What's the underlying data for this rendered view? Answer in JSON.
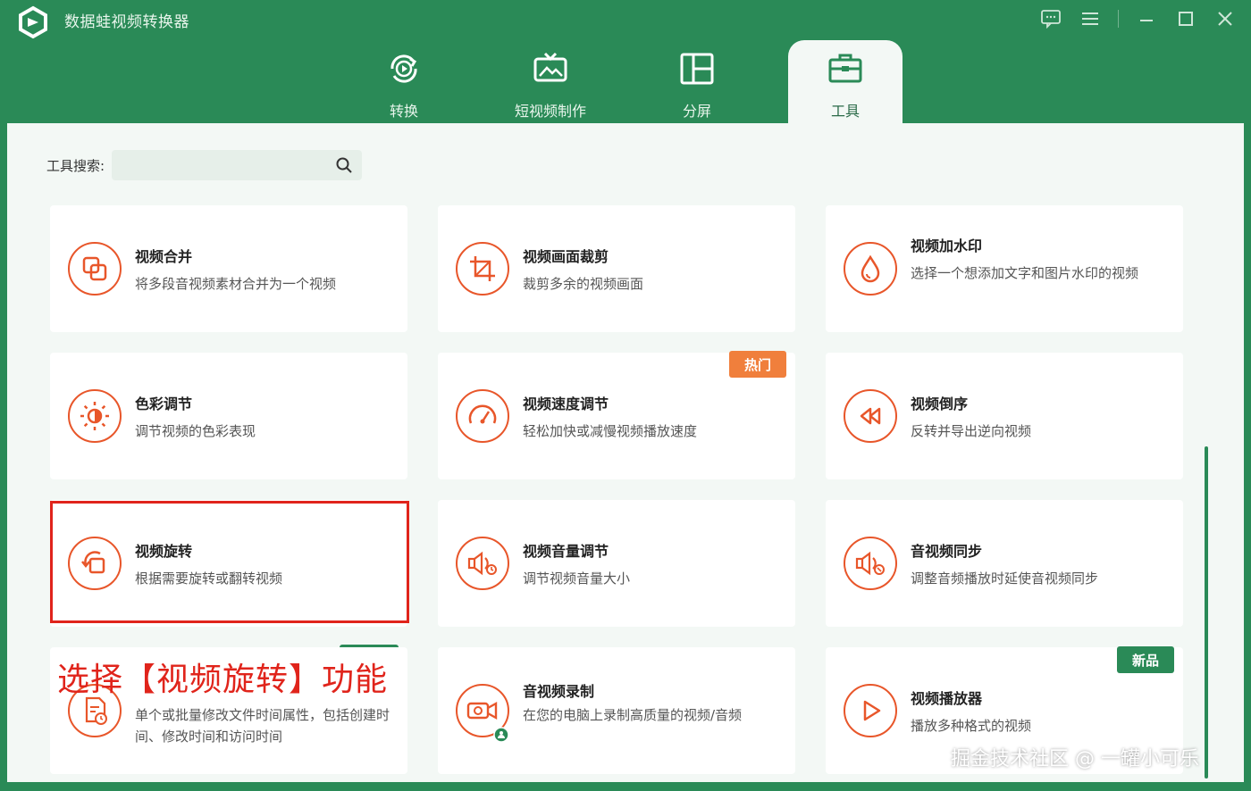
{
  "app": {
    "title": "数据蛙视频转换器"
  },
  "tabs": [
    {
      "label": "转换",
      "icon": "convert-icon"
    },
    {
      "label": "短视频制作",
      "icon": "tv-icon"
    },
    {
      "label": "分屏",
      "icon": "split-screen-icon"
    },
    {
      "label": "工具",
      "icon": "toolbox-icon",
      "active": true
    }
  ],
  "search": {
    "label": "工具搜索:",
    "placeholder": "",
    "value": ""
  },
  "tools": [
    {
      "title": "视频合并",
      "desc": "将多段音视频素材合并为一个视频",
      "icon": "merge-icon"
    },
    {
      "title": "视频画面裁剪",
      "desc": "裁剪多余的视频画面",
      "icon": "crop-icon"
    },
    {
      "title": "视频加水印",
      "desc": "选择一个想添加文字和图片水印的视频",
      "icon": "watermark-drop-icon"
    },
    {
      "title": "色彩调节",
      "desc": "调节视频的色彩表现",
      "icon": "color-adjust-icon"
    },
    {
      "title": "视频速度调节",
      "desc": "轻松加快或减慢视频播放速度",
      "icon": "speedometer-icon",
      "badge": "热门"
    },
    {
      "title": "视频倒序",
      "desc": "反转并导出逆向视频",
      "icon": "rewind-icon"
    },
    {
      "title": "视频旋转",
      "desc": "根据需要旋转或翻转视频",
      "icon": "rotate-icon"
    },
    {
      "title": "视频音量调节",
      "desc": "调节视频音量大小",
      "icon": "volume-icon"
    },
    {
      "title": "音视频同步",
      "desc": "调整音频播放时延使音视频同步",
      "icon": "av-sync-icon"
    },
    {
      "title": "",
      "desc": "单个或批量修改文件时间属性，包括创建时间、修改时间和访问时间",
      "icon": "file-time-icon"
    },
    {
      "title": "音视频录制",
      "desc": "在您的电脑上录制高质量的视频/音频",
      "icon": "recorder-icon"
    },
    {
      "title": "视频播放器",
      "desc": "播放多种格式的视频",
      "icon": "play-icon",
      "badge": "新品"
    }
  ],
  "colors": {
    "brand": "#2a8a57",
    "accent": "#e8562a",
    "hot_badge": "#f07f3c",
    "new_badge": "#2a8a57",
    "highlight": "#e0241b"
  },
  "annotation": {
    "caption": "选择【视频旋转】功能"
  },
  "watermark": "掘金技术社区 @ 一罐小可乐"
}
